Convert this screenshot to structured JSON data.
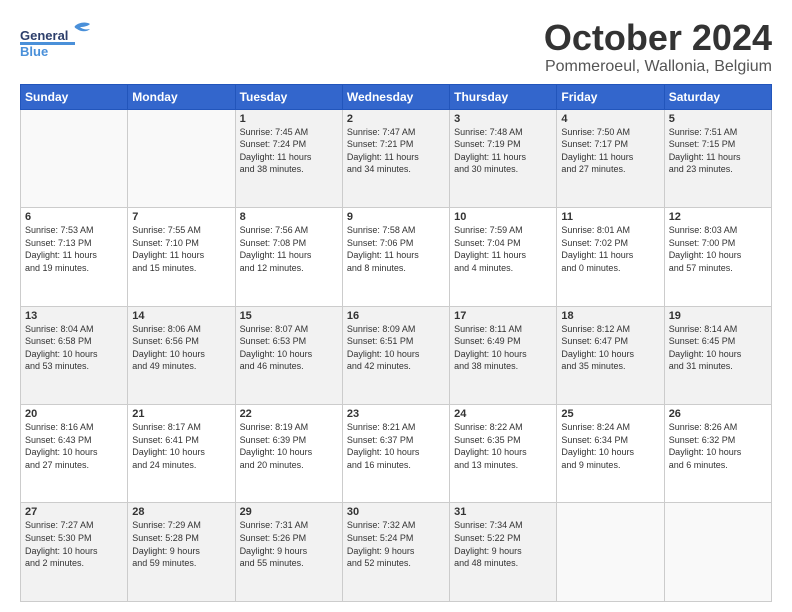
{
  "header": {
    "logo_general": "General",
    "logo_blue": "Blue",
    "title": "October 2024",
    "location": "Pommeroeul, Wallonia, Belgium"
  },
  "columns": [
    "Sunday",
    "Monday",
    "Tuesday",
    "Wednesday",
    "Thursday",
    "Friday",
    "Saturday"
  ],
  "weeks": [
    {
      "shade": "shaded",
      "days": [
        {
          "num": "",
          "info": ""
        },
        {
          "num": "",
          "info": ""
        },
        {
          "num": "1",
          "info": "Sunrise: 7:45 AM\nSunset: 7:24 PM\nDaylight: 11 hours\nand 38 minutes."
        },
        {
          "num": "2",
          "info": "Sunrise: 7:47 AM\nSunset: 7:21 PM\nDaylight: 11 hours\nand 34 minutes."
        },
        {
          "num": "3",
          "info": "Sunrise: 7:48 AM\nSunset: 7:19 PM\nDaylight: 11 hours\nand 30 minutes."
        },
        {
          "num": "4",
          "info": "Sunrise: 7:50 AM\nSunset: 7:17 PM\nDaylight: 11 hours\nand 27 minutes."
        },
        {
          "num": "5",
          "info": "Sunrise: 7:51 AM\nSunset: 7:15 PM\nDaylight: 11 hours\nand 23 minutes."
        }
      ]
    },
    {
      "shade": "white",
      "days": [
        {
          "num": "6",
          "info": "Sunrise: 7:53 AM\nSunset: 7:13 PM\nDaylight: 11 hours\nand 19 minutes."
        },
        {
          "num": "7",
          "info": "Sunrise: 7:55 AM\nSunset: 7:10 PM\nDaylight: 11 hours\nand 15 minutes."
        },
        {
          "num": "8",
          "info": "Sunrise: 7:56 AM\nSunset: 7:08 PM\nDaylight: 11 hours\nand 12 minutes."
        },
        {
          "num": "9",
          "info": "Sunrise: 7:58 AM\nSunset: 7:06 PM\nDaylight: 11 hours\nand 8 minutes."
        },
        {
          "num": "10",
          "info": "Sunrise: 7:59 AM\nSunset: 7:04 PM\nDaylight: 11 hours\nand 4 minutes."
        },
        {
          "num": "11",
          "info": "Sunrise: 8:01 AM\nSunset: 7:02 PM\nDaylight: 11 hours\nand 0 minutes."
        },
        {
          "num": "12",
          "info": "Sunrise: 8:03 AM\nSunset: 7:00 PM\nDaylight: 10 hours\nand 57 minutes."
        }
      ]
    },
    {
      "shade": "shaded",
      "days": [
        {
          "num": "13",
          "info": "Sunrise: 8:04 AM\nSunset: 6:58 PM\nDaylight: 10 hours\nand 53 minutes."
        },
        {
          "num": "14",
          "info": "Sunrise: 8:06 AM\nSunset: 6:56 PM\nDaylight: 10 hours\nand 49 minutes."
        },
        {
          "num": "15",
          "info": "Sunrise: 8:07 AM\nSunset: 6:53 PM\nDaylight: 10 hours\nand 46 minutes."
        },
        {
          "num": "16",
          "info": "Sunrise: 8:09 AM\nSunset: 6:51 PM\nDaylight: 10 hours\nand 42 minutes."
        },
        {
          "num": "17",
          "info": "Sunrise: 8:11 AM\nSunset: 6:49 PM\nDaylight: 10 hours\nand 38 minutes."
        },
        {
          "num": "18",
          "info": "Sunrise: 8:12 AM\nSunset: 6:47 PM\nDaylight: 10 hours\nand 35 minutes."
        },
        {
          "num": "19",
          "info": "Sunrise: 8:14 AM\nSunset: 6:45 PM\nDaylight: 10 hours\nand 31 minutes."
        }
      ]
    },
    {
      "shade": "white",
      "days": [
        {
          "num": "20",
          "info": "Sunrise: 8:16 AM\nSunset: 6:43 PM\nDaylight: 10 hours\nand 27 minutes."
        },
        {
          "num": "21",
          "info": "Sunrise: 8:17 AM\nSunset: 6:41 PM\nDaylight: 10 hours\nand 24 minutes."
        },
        {
          "num": "22",
          "info": "Sunrise: 8:19 AM\nSunset: 6:39 PM\nDaylight: 10 hours\nand 20 minutes."
        },
        {
          "num": "23",
          "info": "Sunrise: 8:21 AM\nSunset: 6:37 PM\nDaylight: 10 hours\nand 16 minutes."
        },
        {
          "num": "24",
          "info": "Sunrise: 8:22 AM\nSunset: 6:35 PM\nDaylight: 10 hours\nand 13 minutes."
        },
        {
          "num": "25",
          "info": "Sunrise: 8:24 AM\nSunset: 6:34 PM\nDaylight: 10 hours\nand 9 minutes."
        },
        {
          "num": "26",
          "info": "Sunrise: 8:26 AM\nSunset: 6:32 PM\nDaylight: 10 hours\nand 6 minutes."
        }
      ]
    },
    {
      "shade": "shaded",
      "days": [
        {
          "num": "27",
          "info": "Sunrise: 7:27 AM\nSunset: 5:30 PM\nDaylight: 10 hours\nand 2 minutes."
        },
        {
          "num": "28",
          "info": "Sunrise: 7:29 AM\nSunset: 5:28 PM\nDaylight: 9 hours\nand 59 minutes."
        },
        {
          "num": "29",
          "info": "Sunrise: 7:31 AM\nSunset: 5:26 PM\nDaylight: 9 hours\nand 55 minutes."
        },
        {
          "num": "30",
          "info": "Sunrise: 7:32 AM\nSunset: 5:24 PM\nDaylight: 9 hours\nand 52 minutes."
        },
        {
          "num": "31",
          "info": "Sunrise: 7:34 AM\nSunset: 5:22 PM\nDaylight: 9 hours\nand 48 minutes."
        },
        {
          "num": "",
          "info": ""
        },
        {
          "num": "",
          "info": ""
        }
      ]
    }
  ]
}
